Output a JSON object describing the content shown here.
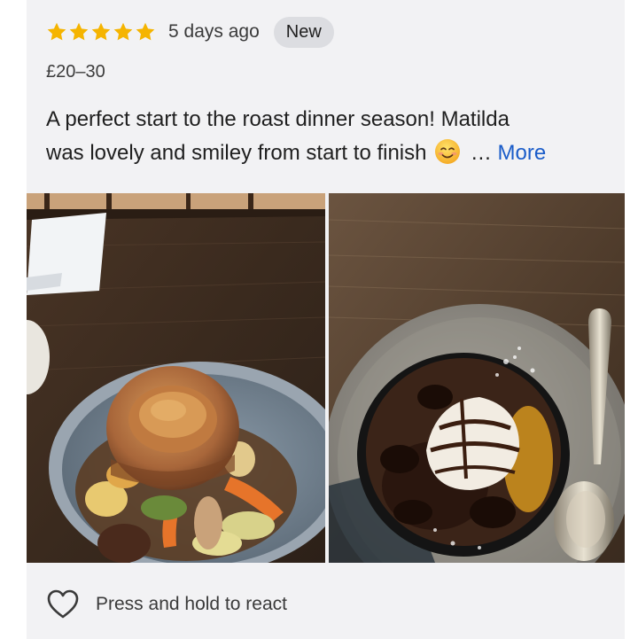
{
  "review": {
    "rating": 5,
    "rating_max": 5,
    "time_ago": "5 days ago",
    "badge": "New",
    "price": "£20–30",
    "text_line1": "A perfect start to the roast dinner season! Matilda",
    "text_line2": "was lovely and smiley from start to finish",
    "ellipsis": " … ",
    "more_label": "More",
    "emoji": "smiling-face-emoji"
  },
  "photos": [
    {
      "subject": "roast-dinner-yorkshire-pudding"
    },
    {
      "subject": "chocolate-brownie-ice-cream"
    }
  ],
  "react": {
    "label": "Press and hold to react",
    "icon": "heart-icon"
  },
  "colors": {
    "star": "#f5b400",
    "link": "#1a5cc9",
    "card_bg": "#f2f2f4",
    "badge_bg": "#dcdde1"
  }
}
